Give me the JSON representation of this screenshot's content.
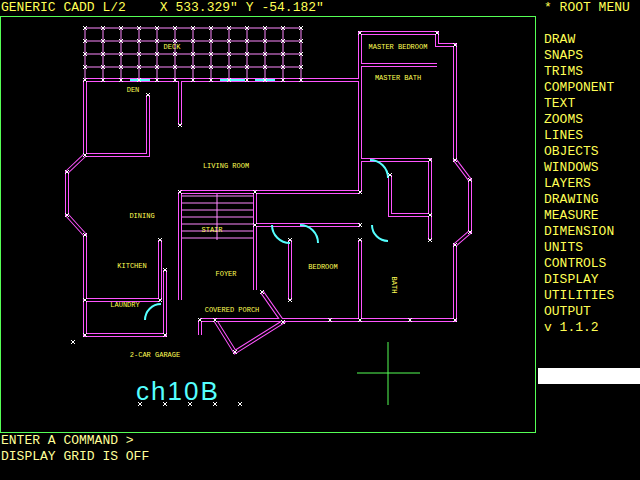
{
  "header": {
    "title": "GENERIC CADD L/2",
    "x": "X 533.329\"",
    "y": "Y -54.182\""
  },
  "menu": {
    "title": "* ROOT MENU",
    "items": [
      "DRAW",
      "SNAPS",
      "TRIMS",
      "COMPONENT",
      "TEXT",
      "ZOOMS",
      "LINES",
      "OBJECTS",
      "WINDOWS",
      "LAYERS",
      "DRAWING",
      "MEASURE",
      "DIMENSION",
      "UNITS",
      "CONTROLS",
      "DISPLAY",
      "UTILITIES",
      "OUTPUT"
    ],
    "version": "v 1.1.2"
  },
  "drawing": {
    "labels": [
      "DECK",
      "DEN",
      "LIVING ROOM",
      "DINING",
      "STAIR",
      "KITCHEN",
      "FOYER",
      "BEDROOM",
      "LAUNDRY",
      "COVERED PORCH",
      "2-CAR GARAGE",
      "MASTER BEDROOM",
      "MASTER BATH",
      "BATH"
    ],
    "stamp": "ch10B"
  },
  "command_line": {
    "prompt": "ENTER A COMMAND >",
    "message": "DISPLAY GRID IS OFF"
  }
}
